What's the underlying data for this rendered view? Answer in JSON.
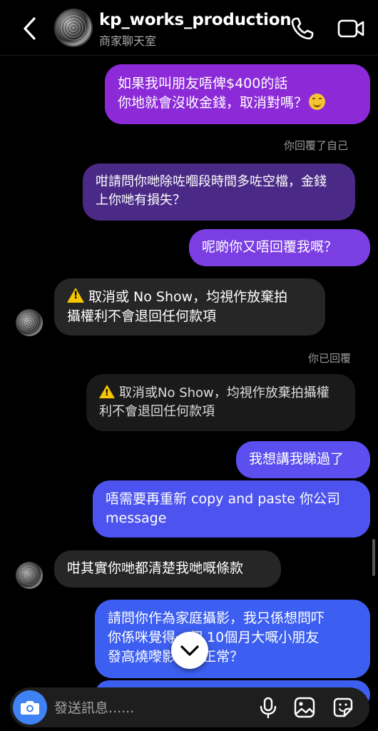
{
  "header": {
    "username": "kp_works_production",
    "subtitle": "商家聊天室"
  },
  "messages": {
    "m1": {
      "lines": [
        "如果我叫朋友唔俾$400的話",
        "你地就會沒收金錢，取消對嗎？"
      ]
    },
    "m2_meta": "你回覆了自己",
    "m2": {
      "lines": [
        "咁請問你哋除咗嗰段時間多咗空檔，金錢",
        "上你哋有損失？"
      ]
    },
    "m3": {
      "text": "呢啲你又唔回覆我嘅？"
    },
    "m4": {
      "lines": [
        "取消或 No Show，均視作放棄拍",
        "攝權利不會退回任何款項"
      ]
    },
    "m5_meta": "你已回覆",
    "m5": {
      "lines": [
        "取消或No Show，均視作放棄拍攝權",
        "利不會退回任何款項"
      ]
    },
    "m6": {
      "text": "我想講我睇過了"
    },
    "m7": {
      "lines": [
        "唔需要再重新 copy and paste 你公司",
        "message"
      ]
    },
    "m8": {
      "text": "咁其實你哋都清楚我哋嘅條款"
    },
    "m9": {
      "lines": [
        "請問你作為家庭攝影，我只係想問吓",
        "你係咪覺得一個 10個月大嘅小朋友",
        "發高燒嚟影係咪正常？"
      ]
    }
  },
  "composer": {
    "placeholder": "發送訊息......"
  },
  "colors": {
    "accent_blue": "#3f82f3",
    "purple": "#8c2ad8",
    "blue": "#3d5ff1"
  },
  "icons": [
    "chevron-left-icon",
    "phone-icon",
    "video-camera-icon",
    "warning-icon",
    "smile-emoji-icon",
    "chevron-down-icon",
    "camera-icon",
    "microphone-icon",
    "image-icon",
    "sticker-icon"
  ]
}
